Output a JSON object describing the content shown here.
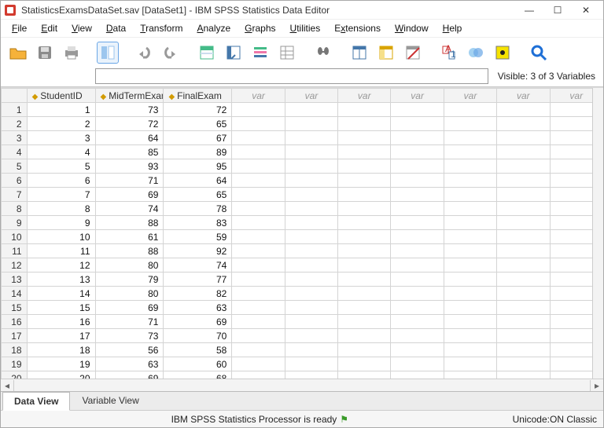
{
  "window": {
    "title": "StatisticsExamsDataSet.sav [DataSet1] - IBM SPSS Statistics Data Editor",
    "minimize": "—",
    "maximize": "☐",
    "close": "✕"
  },
  "menu": {
    "file": "File",
    "edit": "Edit",
    "view": "View",
    "data": "Data",
    "transform": "Transform",
    "analyze": "Analyze",
    "graphs": "Graphs",
    "utilities": "Utilities",
    "extensions": "Extensions",
    "window": "Window",
    "help": "Help"
  },
  "goto": {
    "value": "",
    "visible": "Visible: 3 of 3 Variables"
  },
  "columns": {
    "c1": "StudentID",
    "c2": "MidTermExam",
    "c3": "FinalExam",
    "var": "var"
  },
  "rows": [
    {
      "n": "1",
      "id": "1",
      "mid": "73",
      "fin": "72"
    },
    {
      "n": "2",
      "id": "2",
      "mid": "72",
      "fin": "65"
    },
    {
      "n": "3",
      "id": "3",
      "mid": "64",
      "fin": "67"
    },
    {
      "n": "4",
      "id": "4",
      "mid": "85",
      "fin": "89"
    },
    {
      "n": "5",
      "id": "5",
      "mid": "93",
      "fin": "95"
    },
    {
      "n": "6",
      "id": "6",
      "mid": "71",
      "fin": "64"
    },
    {
      "n": "7",
      "id": "7",
      "mid": "69",
      "fin": "65"
    },
    {
      "n": "8",
      "id": "8",
      "mid": "74",
      "fin": "78"
    },
    {
      "n": "9",
      "id": "9",
      "mid": "88",
      "fin": "83"
    },
    {
      "n": "10",
      "id": "10",
      "mid": "61",
      "fin": "59"
    },
    {
      "n": "11",
      "id": "11",
      "mid": "88",
      "fin": "92"
    },
    {
      "n": "12",
      "id": "12",
      "mid": "80",
      "fin": "74"
    },
    {
      "n": "13",
      "id": "13",
      "mid": "79",
      "fin": "77"
    },
    {
      "n": "14",
      "id": "14",
      "mid": "80",
      "fin": "82"
    },
    {
      "n": "15",
      "id": "15",
      "mid": "69",
      "fin": "63"
    },
    {
      "n": "16",
      "id": "16",
      "mid": "71",
      "fin": "69"
    },
    {
      "n": "17",
      "id": "17",
      "mid": "73",
      "fin": "70"
    },
    {
      "n": "18",
      "id": "18",
      "mid": "56",
      "fin": "58"
    },
    {
      "n": "19",
      "id": "19",
      "mid": "63",
      "fin": "60"
    },
    {
      "n": "20",
      "id": "20",
      "mid": "69",
      "fin": "68"
    }
  ],
  "tabs": {
    "data": "Data View",
    "var": "Variable View"
  },
  "status": {
    "center": "IBM SPSS Statistics Processor is ready",
    "right": "Unicode:ON Classic"
  }
}
